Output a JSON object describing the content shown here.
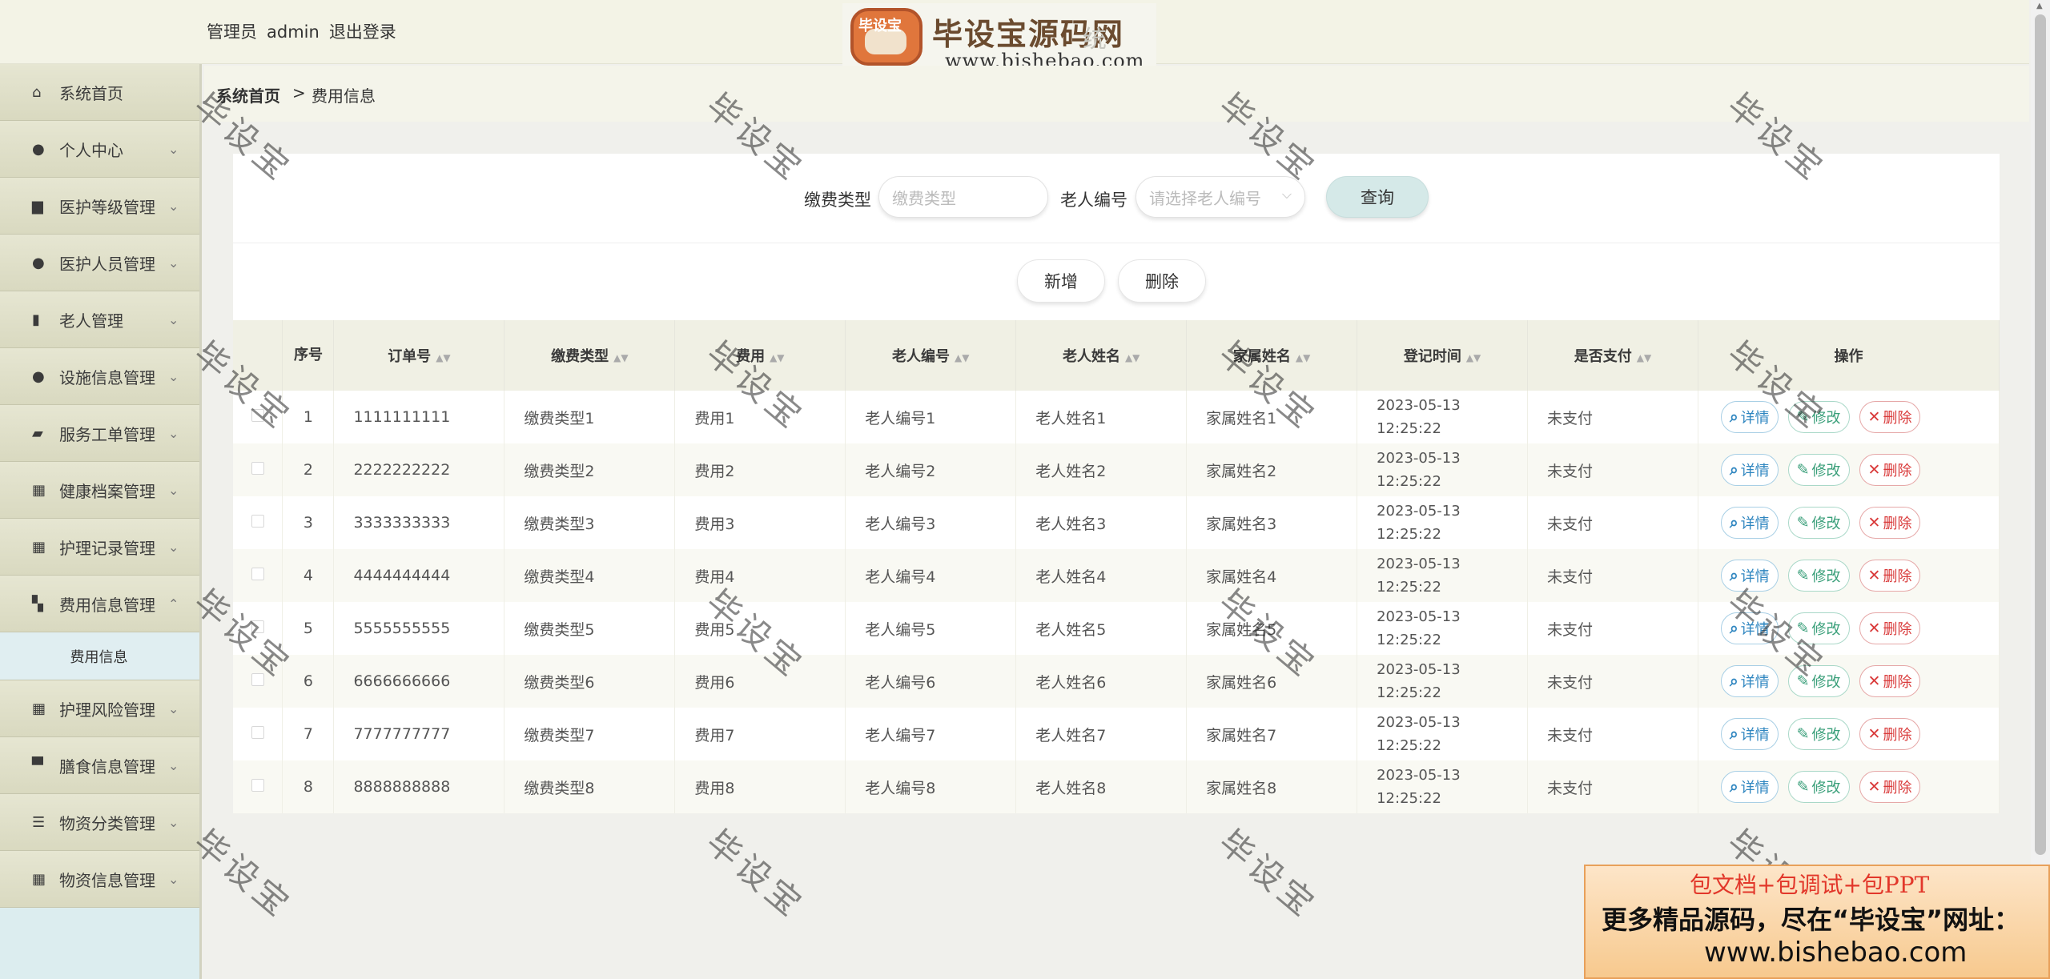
{
  "header": {
    "user_role": "管理员",
    "username": "admin",
    "logout": "退出登录"
  },
  "logo": {
    "badge_text": "毕设宝",
    "name": "毕设宝源码网",
    "faint_suffix": "统",
    "url": "www.bishebao.com"
  },
  "sidebar": {
    "items": [
      {
        "label": "系统首页",
        "icon": "home-icon",
        "glyph": "⌂",
        "expandable": false
      },
      {
        "label": "个人中心",
        "icon": "user-icon",
        "glyph": "●",
        "expandable": true
      },
      {
        "label": "医护等级管理",
        "icon": "briefcase-icon",
        "glyph": "▆",
        "expandable": true
      },
      {
        "label": "医护人员管理",
        "icon": "user-icon",
        "glyph": "●",
        "expandable": true
      },
      {
        "label": "老人管理",
        "icon": "book-icon",
        "glyph": "▮",
        "expandable": true
      },
      {
        "label": "设施信息管理",
        "icon": "user-icon",
        "glyph": "●",
        "expandable": true
      },
      {
        "label": "服务工单管理",
        "icon": "cube-icon",
        "glyph": "▰",
        "expandable": true
      },
      {
        "label": "健康档案管理",
        "icon": "grid-icon",
        "glyph": "▦",
        "expandable": true
      },
      {
        "label": "护理记录管理",
        "icon": "grid-icon",
        "glyph": "▦",
        "expandable": true
      },
      {
        "label": "费用信息管理",
        "icon": "ticket-icon",
        "glyph": "▚",
        "expandable": true,
        "expanded": true
      },
      {
        "label": "护理风险管理",
        "icon": "grid-icon",
        "glyph": "▦",
        "expandable": true
      },
      {
        "label": "膳食信息管理",
        "icon": "monitor-icon",
        "glyph": "▀",
        "expandable": true
      },
      {
        "label": "物资分类管理",
        "icon": "list-icon",
        "glyph": "☰",
        "expandable": true
      },
      {
        "label": "物资信息管理",
        "icon": "grid-icon",
        "glyph": "▦",
        "expandable": true
      }
    ],
    "submenu": "费用信息"
  },
  "breadcrumb": {
    "home": "系统首页",
    "separator": ">",
    "current": "费用信息"
  },
  "search": {
    "type_label": "缴费类型",
    "type_placeholder": "缴费类型",
    "elder_label": "老人编号",
    "elder_placeholder": "请选择老人编号",
    "query_button": "查询"
  },
  "actions": {
    "add": "新增",
    "delete": "删除"
  },
  "table": {
    "columns": [
      "序号",
      "订单号",
      "缴费类型",
      "费用",
      "老人编号",
      "老人姓名",
      "家属姓名",
      "登记时间",
      "是否支付",
      "操作"
    ],
    "rows": [
      {
        "idx": "1",
        "order": "1111111111",
        "type": "缴费类型1",
        "fee": "费用1",
        "elder_no": "老人编号1",
        "elder_name": "老人姓名1",
        "family": "家属姓名1",
        "time": "2023-05-13 12:25:22",
        "paid": "未支付"
      },
      {
        "idx": "2",
        "order": "2222222222",
        "type": "缴费类型2",
        "fee": "费用2",
        "elder_no": "老人编号2",
        "elder_name": "老人姓名2",
        "family": "家属姓名2",
        "time": "2023-05-13 12:25:22",
        "paid": "未支付"
      },
      {
        "idx": "3",
        "order": "3333333333",
        "type": "缴费类型3",
        "fee": "费用3",
        "elder_no": "老人编号3",
        "elder_name": "老人姓名3",
        "family": "家属姓名3",
        "time": "2023-05-13 12:25:22",
        "paid": "未支付"
      },
      {
        "idx": "4",
        "order": "4444444444",
        "type": "缴费类型4",
        "fee": "费用4",
        "elder_no": "老人编号4",
        "elder_name": "老人姓名4",
        "family": "家属姓名4",
        "time": "2023-05-13 12:25:22",
        "paid": "未支付"
      },
      {
        "idx": "5",
        "order": "5555555555",
        "type": "缴费类型5",
        "fee": "费用5",
        "elder_no": "老人编号5",
        "elder_name": "老人姓名5",
        "family": "家属姓名5",
        "time": "2023-05-13 12:25:22",
        "paid": "未支付"
      },
      {
        "idx": "6",
        "order": "6666666666",
        "type": "缴费类型6",
        "fee": "费用6",
        "elder_no": "老人编号6",
        "elder_name": "老人姓名6",
        "family": "家属姓名6",
        "time": "2023-05-13 12:25:22",
        "paid": "未支付"
      },
      {
        "idx": "7",
        "order": "7777777777",
        "type": "缴费类型7",
        "fee": "费用7",
        "elder_no": "老人编号7",
        "elder_name": "老人姓名7",
        "family": "家属姓名7",
        "time": "2023-05-13 12:25:22",
        "paid": "未支付"
      },
      {
        "idx": "8",
        "order": "8888888888",
        "type": "缴费类型8",
        "fee": "费用8",
        "elder_no": "老人编号8",
        "elder_name": "老人姓名8",
        "family": "家属姓名8",
        "time": "2023-05-13 12:25:22",
        "paid": "未支付"
      }
    ],
    "op_labels": {
      "detail": "详情",
      "edit": "修改",
      "delete": "删除"
    }
  },
  "watermark": "毕设宝",
  "promo": {
    "line1": "包文档+包调试+包PPT",
    "line2": "更多精品源码，尽在“毕设宝”网址：",
    "line3": "www.bishebao.com"
  },
  "colors": {
    "menu_bg": "#dedec8",
    "submenu_bg": "#e0eef1",
    "query_btn": "#d5e9e8",
    "detail": "#2f86c0",
    "edit": "#3a9f7a",
    "delete": "#d93a3a"
  }
}
